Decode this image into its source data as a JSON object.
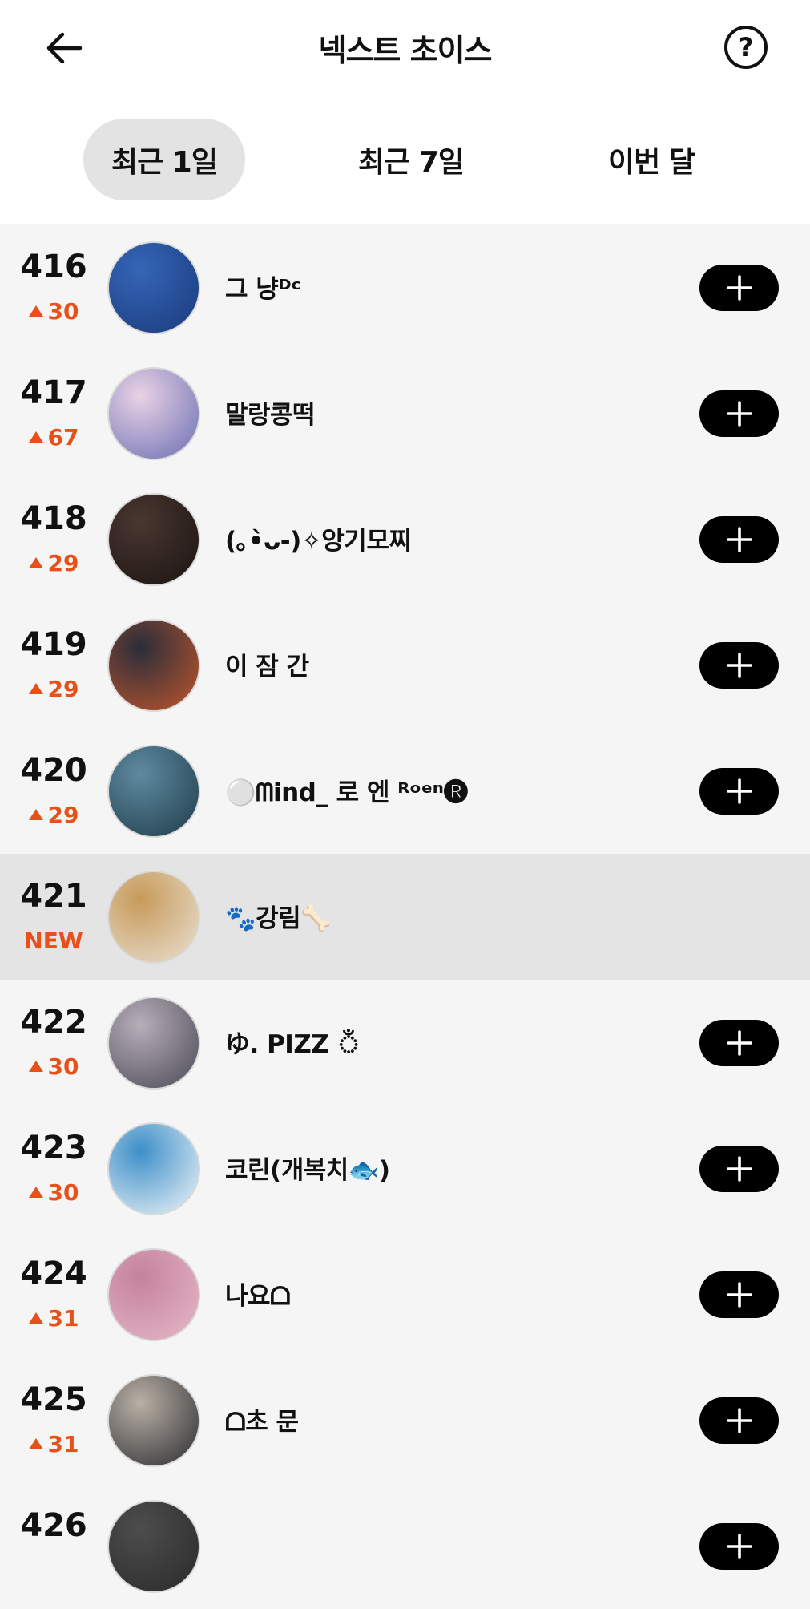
{
  "header": {
    "title": "넥스트 초이스",
    "back_icon": "arrow-left-icon",
    "help_icon": "question-circle-icon",
    "help_glyph": "?"
  },
  "tabs": [
    {
      "label": "최근 1일",
      "active": true
    },
    {
      "label": "최근 7일",
      "active": false
    },
    {
      "label": "이번 달",
      "active": false
    }
  ],
  "rows": [
    {
      "rank": "416",
      "delta": "30",
      "name": "그 냥ᴰᶜ",
      "highlighted": false,
      "avatar_colors": [
        "#1a3a7a",
        "#3566b8"
      ]
    },
    {
      "rank": "417",
      "delta": "67",
      "name": "말랑콩떡",
      "highlighted": false,
      "avatar_colors": [
        "#6b6fb2",
        "#e9d2e6"
      ]
    },
    {
      "rank": "418",
      "delta": "29",
      "name": "(｡•̀ᴗ-)✧앙기모찌",
      "highlighted": false,
      "avatar_colors": [
        "#1a1412",
        "#4a3630"
      ]
    },
    {
      "rank": "419",
      "delta": "29",
      "name": "이 잠 간",
      "highlighted": false,
      "avatar_colors": [
        "#c0562c",
        "#2a2d3a"
      ]
    },
    {
      "rank": "420",
      "delta": "29",
      "name": "⚪️ᗰind_ 로 엔 ᴿᵒᵉⁿ🅡",
      "highlighted": false,
      "avatar_colors": [
        "#1f3c4a",
        "#5e8aa0"
      ]
    },
    {
      "rank": "421",
      "delta": "NEW",
      "name": "🐾강림🦴",
      "highlighted": true,
      "avatar_colors": [
        "#e9e1d4",
        "#c79a5a"
      ]
    },
    {
      "rank": "422",
      "delta": "30",
      "name": "ゆ. PIZZ ঁ",
      "highlighted": false,
      "avatar_colors": [
        "#4a4a55",
        "#b7aeb8"
      ]
    },
    {
      "rank": "423",
      "delta": "30",
      "name": "코린(개복치🐟)",
      "highlighted": false,
      "avatar_colors": [
        "#f2f5f8",
        "#3c8fc8"
      ]
    },
    {
      "rank": "424",
      "delta": "31",
      "name": "나요ᗝ",
      "highlighted": false,
      "avatar_colors": [
        "#e6b8c8",
        "#c4829c"
      ]
    },
    {
      "rank": "425",
      "delta": "31",
      "name": "ᗝ초 문",
      "highlighted": false,
      "avatar_colors": [
        "#2b2b30",
        "#b9b1a6"
      ]
    },
    {
      "rank": "426",
      "delta": "",
      "name": "",
      "highlighted": false,
      "avatar_colors": [
        "#2a2a2a",
        "#4d4d4d"
      ]
    }
  ],
  "colors": {
    "accent_orange": "#e8501a",
    "highlight_row": "#e4e4e4",
    "list_bg": "#f5f5f5",
    "tab_active_bg": "#e3e3e3",
    "add_button_bg": "#000000"
  },
  "icons": {
    "delta_up": "triangle-up-icon",
    "add": "plus-icon"
  }
}
